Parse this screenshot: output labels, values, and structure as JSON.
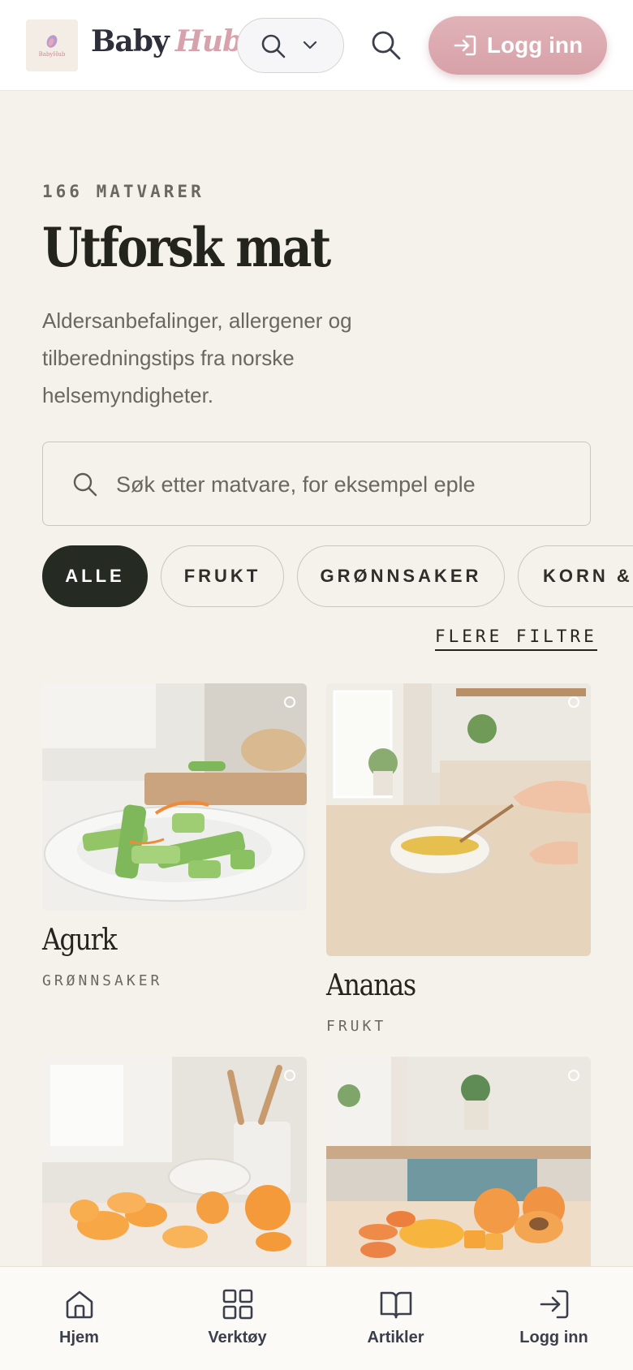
{
  "header": {
    "logo_text": "BabyHub",
    "brand_first": "Baby",
    "brand_second": "Hub",
    "login_label": "Logg inn"
  },
  "hero": {
    "eyebrow": "166 MATVARER",
    "title": "Utforsk mat",
    "subtitle": "Aldersanbefalinger, allergener og tilberedningstips fra norske helsemyndigheter."
  },
  "search": {
    "placeholder": "Søk etter matvare, for eksempel eple"
  },
  "chips": [
    {
      "label": "ALLE",
      "active": true
    },
    {
      "label": "FRUKT",
      "active": false
    },
    {
      "label": "GRØNNSAKER",
      "active": false
    },
    {
      "label": "KORN &",
      "active": false
    }
  ],
  "more_filters": "FLERE FILTRE",
  "cards": [
    {
      "name": "Agurk",
      "category": "GRØNNSAKER"
    },
    {
      "name": "Ananas",
      "category": "FRUKT"
    },
    {
      "name": "",
      "category": ""
    },
    {
      "name": "",
      "category": ""
    }
  ],
  "nav": [
    {
      "label": "Hjem",
      "icon": "home-icon"
    },
    {
      "label": "Verktøy",
      "icon": "grid-icon"
    },
    {
      "label": "Artikler",
      "icon": "book-icon"
    },
    {
      "label": "Logg inn",
      "icon": "login-icon"
    }
  ],
  "colors": {
    "background": "#f5f2ec",
    "accent_pink": "#d7a2ab",
    "dark_chip": "#252a22",
    "text_dark": "#24241f"
  }
}
